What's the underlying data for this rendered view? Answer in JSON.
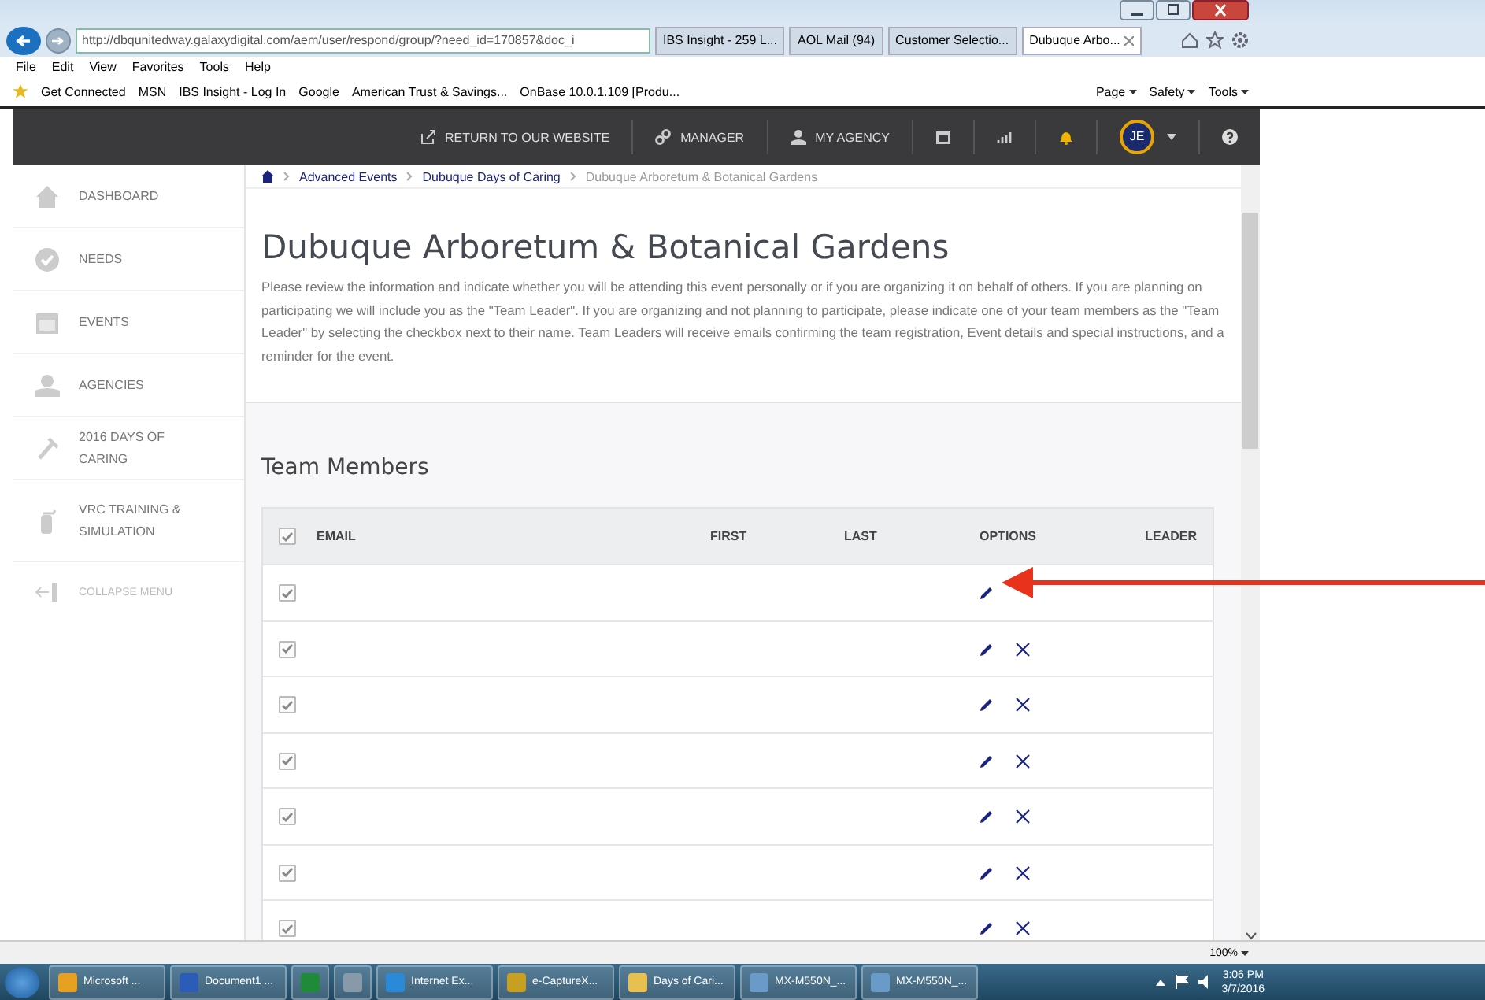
{
  "browser": {
    "address": "http://dbqunitedway.galaxydigital.com/aem/user/respond/group/?need_id=170857&doc_i",
    "tabs": [
      {
        "label": "IBS Insight - 259 L...",
        "selected": false
      },
      {
        "label": "AOL Mail (94)",
        "selected": false
      },
      {
        "label": "Customer Selectio...",
        "selected": false
      },
      {
        "label": "Dubuque Arbo...",
        "selected": true
      }
    ],
    "menu": [
      "File",
      "Edit",
      "View",
      "Favorites",
      "Tools",
      "Help"
    ],
    "favorites": [
      "Get Connected",
      "MSN",
      "IBS Insight - Log In",
      "Google",
      "American Trust & Savings...",
      "OnBase 10.0.1.109 [Produ..."
    ],
    "command_bar": [
      "Page",
      "Safety",
      "Tools"
    ]
  },
  "topnav": {
    "items": [
      "RETURN TO OUR WEBSITE",
      "MANAGER",
      "MY AGENCY"
    ],
    "avatar": "JE"
  },
  "breadcrumb": [
    "Advanced Events",
    "Dubuque Days of Caring",
    "Dubuque Arboretum & Botanical Gardens"
  ],
  "sidebar": {
    "items": [
      "DASHBOARD",
      "NEEDS",
      "EVENTS",
      "AGENCIES",
      "2016 DAYS OF CARING",
      "VRC TRAINING & SIMULATION"
    ],
    "collapse": "COLLAPSE MENU"
  },
  "page": {
    "title": "Dubuque Arboretum & Botanical Gardens",
    "intro": "Please review the information and indicate whether you will be attending this event personally or if you are organizing it on behalf of others. If you are planning on participating we will include you as the \"Team Leader\". If you are organizing and not planning to participate, please indicate one of your team members as the \"Team Leader\" by selecting the checkbox next to their name. Team Leaders will receive emails confirming the team registration, Event details and special instructions, and a reminder for the event."
  },
  "team": {
    "title": "Team Members",
    "columns": [
      "EMAIL",
      "FIRST",
      "LAST",
      "OPTIONS",
      "LEADER"
    ],
    "header_checked": true,
    "rows": [
      {
        "checked": true
      },
      {
        "checked": true
      },
      {
        "checked": true
      },
      {
        "checked": true
      },
      {
        "checked": true
      },
      {
        "checked": true
      },
      {
        "checked": true
      }
    ]
  },
  "zoom": "100%",
  "taskbar": {
    "items": [
      {
        "kind": "labeled",
        "label": "Microsoft ..."
      },
      {
        "kind": "labeled",
        "label": "Document1 ..."
      },
      {
        "kind": "icon"
      },
      {
        "kind": "icon"
      },
      {
        "kind": "labeled",
        "label": "Internet Ex..."
      },
      {
        "kind": "labeled",
        "label": "e-CaptureX..."
      },
      {
        "kind": "labeled",
        "label": "Days of Cari..."
      },
      {
        "kind": "labeled",
        "label": "MX-M550N_..."
      },
      {
        "kind": "labeled",
        "label": "MX-M550N_..."
      }
    ],
    "time": "3:06 PM",
    "date": "3/7/2016"
  }
}
